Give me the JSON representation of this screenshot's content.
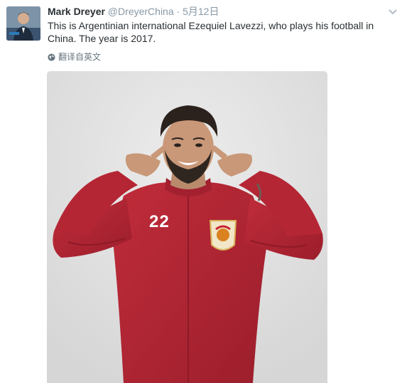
{
  "tweet": {
    "author": {
      "name": "Mark Dreyer",
      "handle": "@DreyerChina",
      "avatar_icon": "profile-photo"
    },
    "separator": "·",
    "timestamp": "5月12日",
    "text": "This is Argentinian international Ezequiel Lavezzi, who plays his football in China. The year is 2017.",
    "translate_label": "翻译自英文",
    "media": {
      "jersey_number": "22",
      "colors": {
        "background": "#e3e3e3",
        "jacket": "#b52634",
        "jacket_shadow": "#8e1a27",
        "skin": "#c99878",
        "hair": "#2b221d"
      }
    }
  }
}
